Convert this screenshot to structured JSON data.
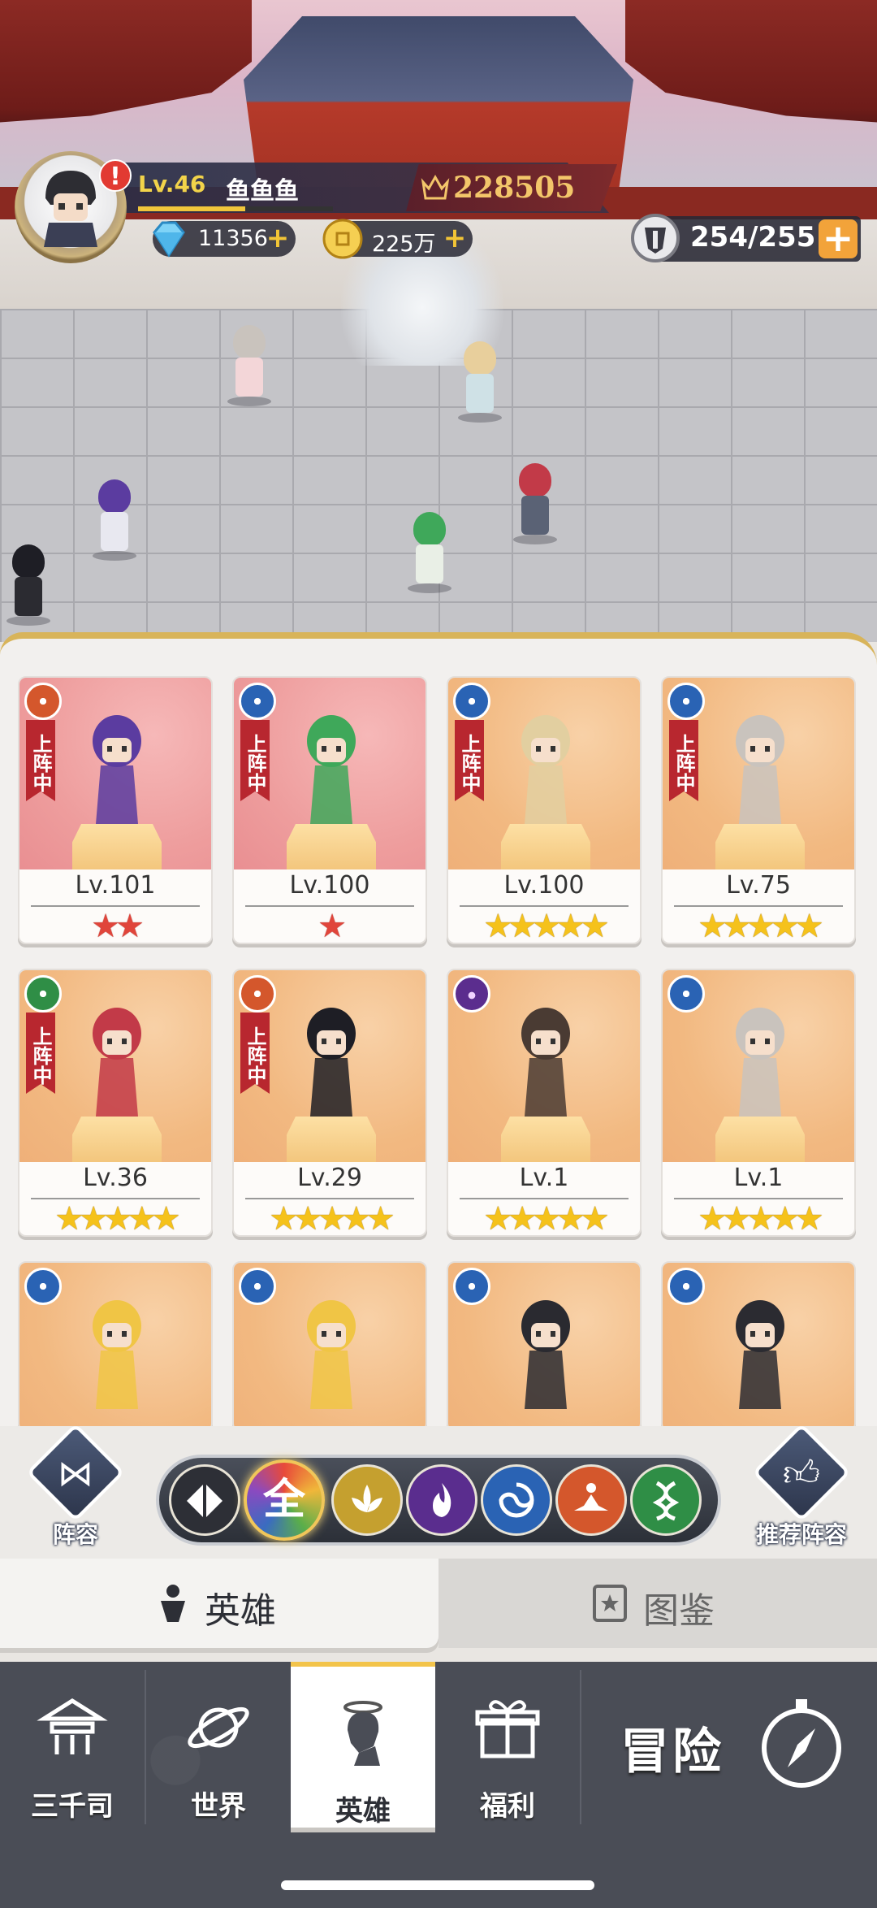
{
  "player": {
    "level_label": "Lv.46",
    "name": "鱼鱼鱼",
    "power": "228505",
    "xp_fraction": 0.55,
    "alert": "!"
  },
  "resources": {
    "diamonds": "11356",
    "gold": "225万",
    "energy": "254/255",
    "plus": "+"
  },
  "heroes": [
    {
      "level": "Lv.101",
      "stars": 2,
      "star_color": "red",
      "deployed": true,
      "deploy_label": "上阵中",
      "element": "lotus"
    },
    {
      "level": "Lv.100",
      "stars": 1,
      "star_color": "red",
      "deployed": true,
      "deploy_label": "上阵中",
      "element": "wind"
    },
    {
      "level": "Lv.100",
      "stars": 5,
      "star_color": "gold",
      "deployed": true,
      "deploy_label": "上阵中",
      "element": "wind"
    },
    {
      "level": "Lv.75",
      "stars": 5,
      "star_color": "gold",
      "deployed": true,
      "deploy_label": "上阵中",
      "element": "wind"
    },
    {
      "level": "Lv.36",
      "stars": 5,
      "star_color": "gold",
      "deployed": true,
      "deploy_label": "上阵中",
      "element": "dna"
    },
    {
      "level": "Lv.29",
      "stars": 5,
      "star_color": "gold",
      "deployed": true,
      "deploy_label": "上阵中",
      "element": "lotus"
    },
    {
      "level": "Lv.1",
      "stars": 5,
      "star_color": "gold",
      "deployed": false,
      "deploy_label": "",
      "element": "fire"
    },
    {
      "level": "Lv.1",
      "stars": 5,
      "star_color": "gold",
      "deployed": false,
      "deploy_label": "",
      "element": "wind"
    },
    {
      "level": "",
      "stars": 0,
      "star_color": "gold",
      "deployed": false,
      "deploy_label": "",
      "element": "wind"
    },
    {
      "level": "",
      "stars": 0,
      "star_color": "gold",
      "deployed": false,
      "deploy_label": "",
      "element": "wind"
    },
    {
      "level": "",
      "stars": 0,
      "star_color": "gold",
      "deployed": false,
      "deploy_label": "",
      "element": "wind"
    },
    {
      "level": "",
      "stars": 0,
      "star_color": "gold",
      "deployed": false,
      "deploy_label": "",
      "element": "wind"
    }
  ],
  "filters": {
    "lineup_label": "阵容",
    "recommend_label": "推荐阵容",
    "all_label": "全",
    "items": [
      "type-toggle",
      "all",
      "lotus-gold",
      "fire",
      "wind",
      "lotus",
      "dna"
    ],
    "selected": "all"
  },
  "tabs": {
    "heroes": "英雄",
    "codex": "图鉴"
  },
  "nav": {
    "sanqiansi": "三千司",
    "world": "世界",
    "heroes": "英雄",
    "welfare": "福利",
    "adventure": "冒险"
  },
  "colors": {
    "gold_accent": "#f3c44a",
    "deploy_red": "#b8272f",
    "nav_bg": "#4a4d56"
  }
}
